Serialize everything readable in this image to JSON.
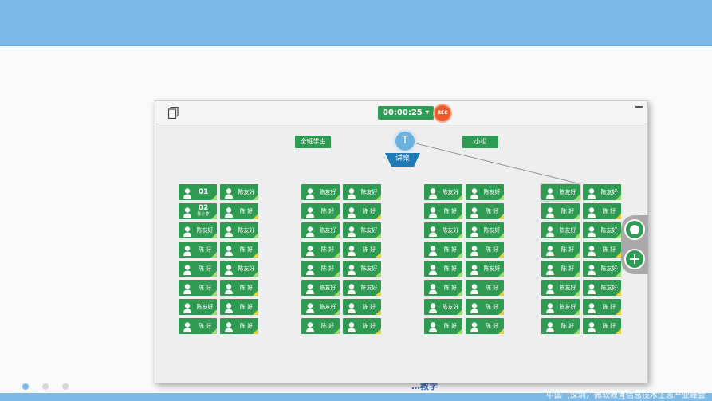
{
  "footer": {
    "organizer": "中国（深圳）微软教育信息技术生态产业峰会"
  },
  "slide_fragment": "…教学",
  "carousel": {
    "total": 3,
    "active": 0
  },
  "classroom": {
    "timer": "00:00:25 ▾",
    "rec_label": "REC",
    "whole_class_label": "全班学生",
    "group_label": "小组",
    "teacher_initial": "T",
    "desk_label": "讲桌"
  },
  "seats": {
    "first": {
      "number": "01"
    },
    "second": {
      "number": "02",
      "sub": "陈小婷"
    },
    "names": {
      "full": "陈友好",
      "short": "陈 好"
    }
  },
  "colors": {
    "accent": "#2f9a52",
    "header_band": "#7db9e7",
    "rec": "#ef5a2a",
    "teacher": "#6ab2df"
  }
}
